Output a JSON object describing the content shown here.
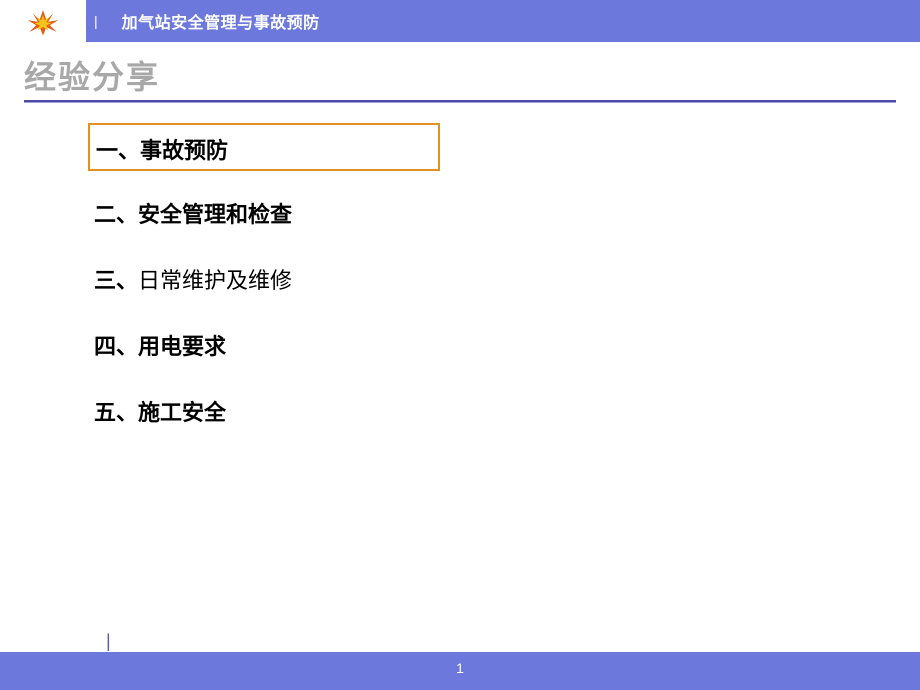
{
  "header": {
    "title": "加气站安全管理与事故预防"
  },
  "section": {
    "title": "经验分享"
  },
  "toc": [
    {
      "text": "一、事故预防",
      "highlighted": true
    },
    {
      "text": "二、安全管理和检查",
      "highlighted": false
    },
    {
      "prefix": "三、",
      "body": "日常维护及维修",
      "highlighted": false
    },
    {
      "text": "四、用电要求",
      "highlighted": false
    },
    {
      "text": "五、施工安全",
      "highlighted": false
    }
  ],
  "footer": {
    "page_number": "1"
  }
}
